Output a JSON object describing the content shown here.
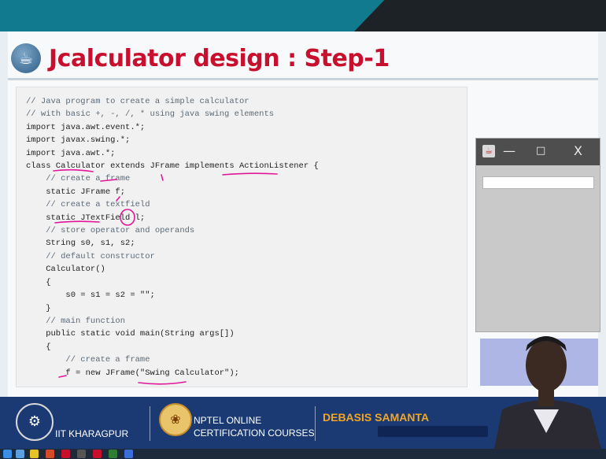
{
  "slide": {
    "title": "Jcalculator design : Step-1"
  },
  "code_lines": [
    "// Java program to create a simple calculator",
    "// with basic +, -, /, * using java swing elements",
    "import java.awt.event.*;",
    "import javax.swing.*;",
    "import java.awt.*;",
    "class Calculator extends JFrame implements ActionListener {",
    "    // create a frame",
    "    static JFrame f;",
    "    // create a textfield",
    "    static JTextField l;",
    "    // store operator and operands",
    "    String s0, s1, s2;",
    "    // default constructor",
    "    Calculator()",
    "    {",
    "        s0 = s1 = s2 = \"\";",
    "    }",
    "    // main function",
    "    public static void main(String args[])",
    "    {",
    "        // create a frame",
    "        f = new JFrame(\"Swing Calculator\");"
  ],
  "swing_window": {
    "minimize_glyph": "—",
    "maximize_glyph": "□",
    "close_glyph": "X"
  },
  "footer": {
    "institute": "IIT KHARAGPUR",
    "nptel_line1": "NPTEL ONLINE",
    "nptel_line2": "CERTIFICATION COURSES",
    "speaker": "DEBASIS SAMANTA"
  },
  "colors": {
    "title_red": "#c8102e",
    "top_teal": "#127a8f",
    "footer_blue": "#1b3a73",
    "speaker_orange": "#f2a623",
    "annotation_magenta": "#e0179a"
  }
}
